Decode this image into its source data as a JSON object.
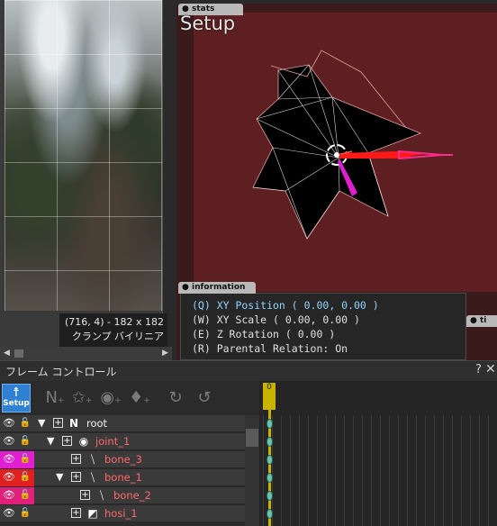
{
  "texture": {
    "coords": "(716, 4) - 182 x 182",
    "mode": "クランプ バイリニア"
  },
  "viewport": {
    "stats_tab": "stats",
    "mode_title": "Setup",
    "timeline_tab": "ti",
    "background_color": "#5e1f22"
  },
  "information": {
    "tab": "information",
    "lines": [
      "(Q) XY Position ( 0.00, 0.00 )",
      "(W) XY Scale ( 0.00, 0.00 )",
      "(E) Z Rotation ( 0.00 )",
      "(R) Parental Relation: On"
    ]
  },
  "frame_control": {
    "title": "フレーム コントロール",
    "help": "?",
    "close": "✕",
    "setup_label": "Setup",
    "toolbar_icons": [
      "new-null-icon",
      "new-star-icon",
      "new-joint-icon",
      "new-bone-icon",
      "rotate-a-icon",
      "reload-a-icon"
    ],
    "current_frame": "0"
  },
  "layers": [
    {
      "name": "root",
      "color": "#f0f0f0",
      "marker": ""
    },
    {
      "name": "joint_1",
      "color": "#ff6a6a",
      "marker": ""
    },
    {
      "name": "bone_3",
      "color": "#ff6a6a",
      "marker": "#e020d0"
    },
    {
      "name": "bone_1",
      "color": "#ff6a6a",
      "marker": "#e02020"
    },
    {
      "name": "bone_2",
      "color": "#ff6a6a",
      "marker": "#e0207a"
    },
    {
      "name": "hosi_1",
      "color": "#ff6a6a",
      "marker": ""
    }
  ],
  "colors": {
    "accent": "#2f7fd3",
    "timeline_cursor": "#c9b300",
    "keyframe": "#69c4b0",
    "bone_x_axis": "#ff2020",
    "bone_y_axis": "#e020d0"
  }
}
